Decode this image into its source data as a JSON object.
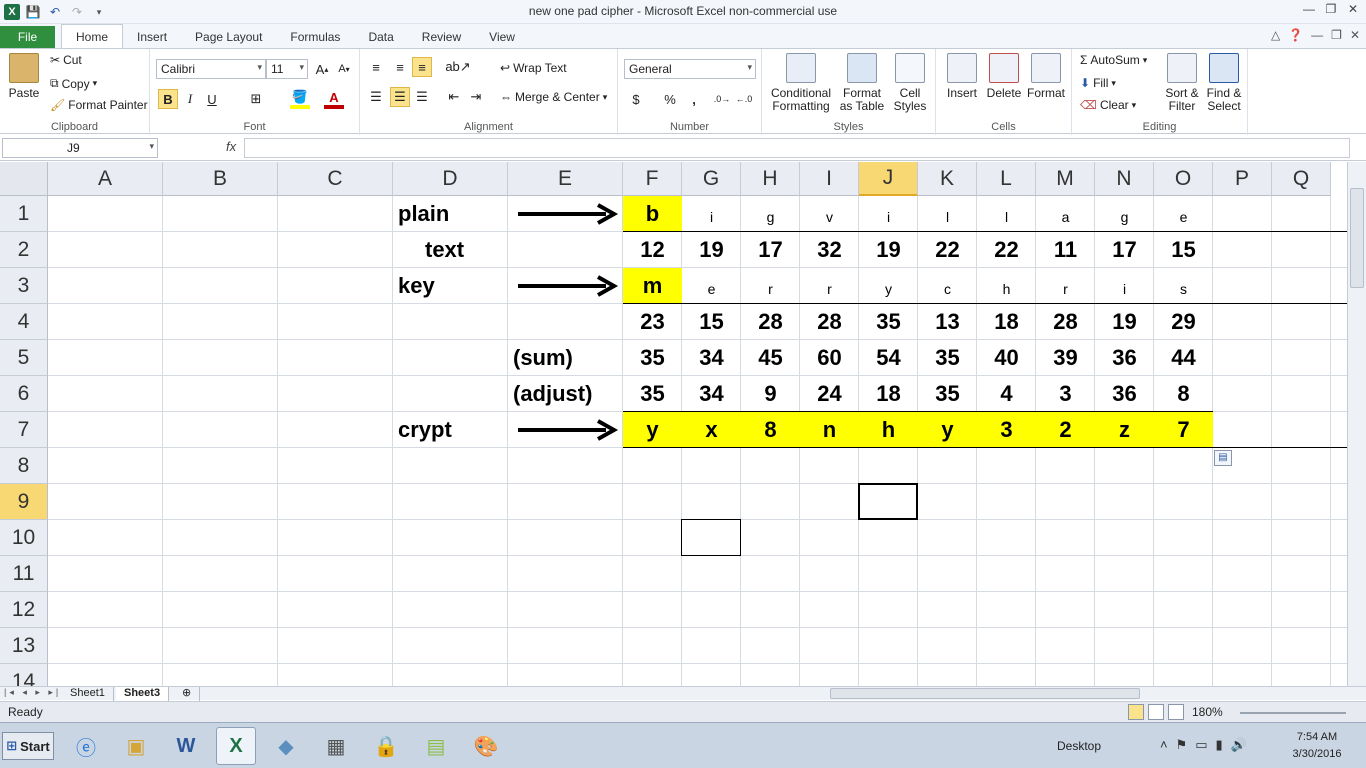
{
  "window": {
    "title": "new one pad cipher - Microsoft Excel non-commercial use"
  },
  "tabs": [
    "File",
    "Home",
    "Insert",
    "Page Layout",
    "Formulas",
    "Data",
    "Review",
    "View"
  ],
  "ribbon": {
    "clipboard": {
      "paste": "Paste",
      "cut": "Cut",
      "copy": "Copy",
      "format_painter": "Format Painter",
      "label": "Clipboard"
    },
    "font": {
      "name": "Calibri",
      "size": "11",
      "bold": "B",
      "italic": "I",
      "underline": "U",
      "label": "Font"
    },
    "alignment": {
      "wrap_text": "Wrap Text",
      "merge_center": "Merge & Center",
      "label": "Alignment"
    },
    "number": {
      "format": "General",
      "currency": "$",
      "percent": "%",
      "comma": ",",
      "label": "Number"
    },
    "styles": {
      "conditional": "Conditional",
      "conditional2": "Formatting",
      "format_as": "Format",
      "format_as2": "as Table",
      "cell": "Cell",
      "cell2": "Styles",
      "label": "Styles"
    },
    "cells": {
      "insert": "Insert",
      "delete": "Delete",
      "format": "Format",
      "label": "Cells"
    },
    "editing": {
      "autosum": "AutoSum",
      "fill": "Fill",
      "clear": "Clear",
      "sort": "Sort &",
      "sort2": "Filter",
      "find": "Find &",
      "find2": "Select",
      "label": "Editing"
    }
  },
  "formula_bar": {
    "name_box": "J9",
    "fx": "fx",
    "content": ""
  },
  "columns": [
    "A",
    "B",
    "C",
    "D",
    "E",
    "F",
    "G",
    "H",
    "I",
    "J",
    "K",
    "L",
    "M",
    "N",
    "O",
    "P",
    "Q"
  ],
  "rows": [
    "1",
    "2",
    "3",
    "4",
    "5",
    "6",
    "7",
    "8",
    "9",
    "10",
    "11",
    "12",
    "13",
    "14"
  ],
  "sheet": {
    "labels": {
      "plain": "plain",
      "text": "text",
      "key": "key",
      "sum": "(sum)",
      "adjust": "(adjust)",
      "crypt": "crypt"
    },
    "plain_letters": [
      "b",
      "i",
      "g",
      "v",
      "i",
      "l",
      "l",
      "a",
      "g",
      "e"
    ],
    "plain_numbers": [
      "12",
      "19",
      "17",
      "32",
      "19",
      "22",
      "22",
      "11",
      "17",
      "15"
    ],
    "key_letters": [
      "m",
      "e",
      "r",
      "r",
      "y",
      "c",
      "h",
      "r",
      "i",
      "s"
    ],
    "key_numbers": [
      "23",
      "15",
      "28",
      "28",
      "35",
      "13",
      "18",
      "28",
      "19",
      "29"
    ],
    "sum_numbers": [
      "35",
      "34",
      "45",
      "60",
      "54",
      "35",
      "40",
      "39",
      "36",
      "44"
    ],
    "adjust_numbers": [
      "35",
      "34",
      "9",
      "24",
      "18",
      "35",
      "4",
      "3",
      "36",
      "8"
    ],
    "crypt_letters": [
      "y",
      "x",
      "8",
      "n",
      "h",
      "y",
      "3",
      "2",
      "z",
      "7"
    ]
  },
  "sheet_tabs": [
    "Sheet1",
    "Sheet3"
  ],
  "status": {
    "ready": "Ready",
    "zoom": "180%"
  },
  "taskbar": {
    "start": "Start",
    "desktop": "Desktop",
    "time": "7:54 AM",
    "date": "3/30/2016"
  },
  "colors": {
    "highlight": "#ffff00",
    "file_tab": "#2f8f3e",
    "selected_header": "#f8d873"
  }
}
